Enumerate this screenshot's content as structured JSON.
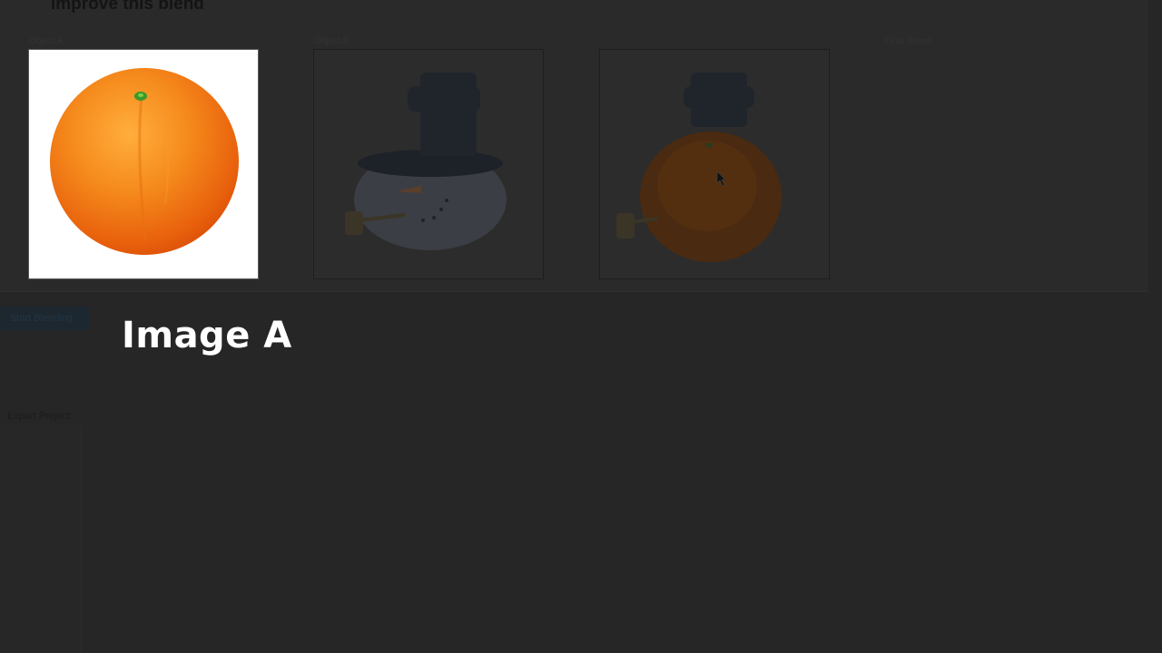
{
  "panel": {
    "title": "Improve this blend",
    "labels": {
      "object_a": "Object A",
      "object_b": "Object B",
      "final": "Final Blend"
    }
  },
  "sidebar": {
    "start_button": "Start Blending",
    "export_link": "Export Project"
  },
  "overlay": {
    "caption": "Image A"
  },
  "images": {
    "object_a": "orange-photo",
    "object_b": "snowman-photo",
    "blend": "orange-snowman-blend"
  },
  "colors": {
    "background": "#262626",
    "orange": "#f07a16",
    "accent_button": "#1c2730"
  }
}
